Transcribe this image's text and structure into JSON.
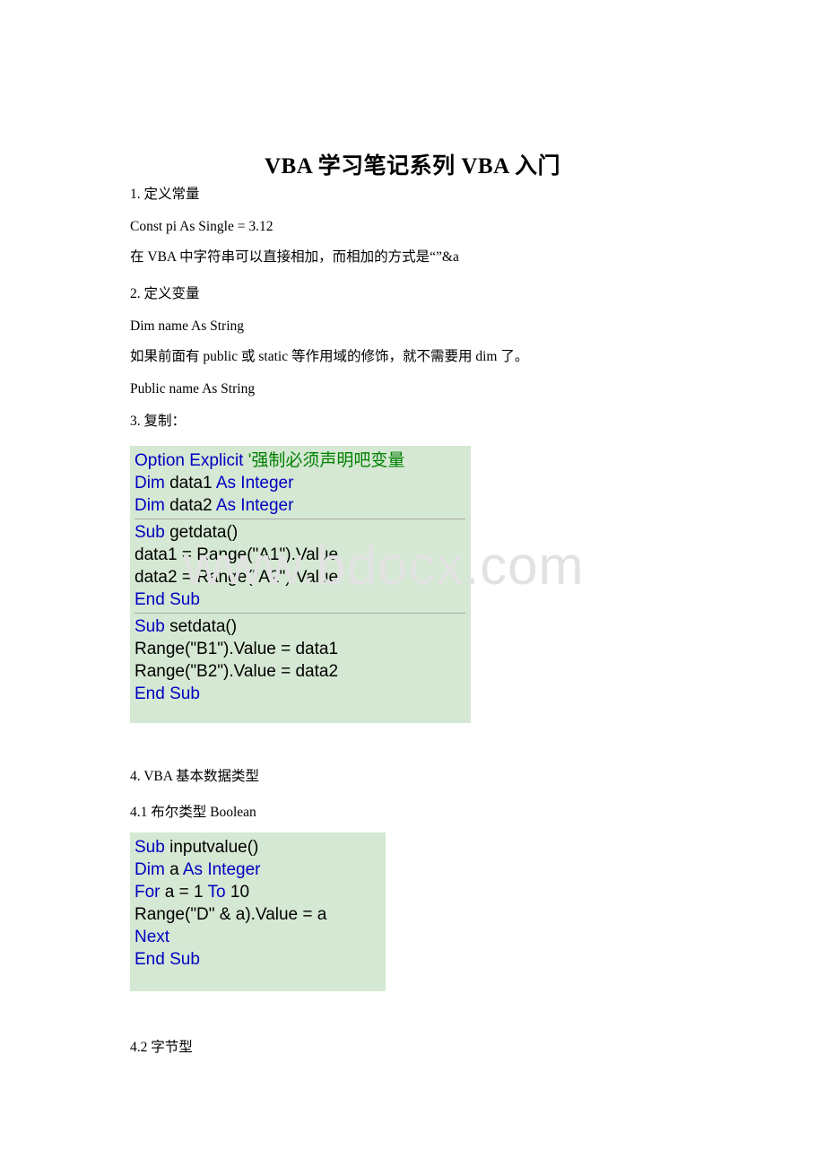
{
  "document": {
    "title": "VBA 学习笔记系列 VBA 入门",
    "watermark": "www.bdocx.com",
    "page_background": "#ffffff",
    "code_background": "#d5e8d3",
    "keyword_color": "#0000c0",
    "comment_color": "#008000",
    "identifier_color": "#000000",
    "watermark_color": "#e2e2e2"
  },
  "paragraphs": [
    {
      "text": "1. 定义常量"
    },
    {
      "text": "Const pi As Single = 3.12"
    },
    {
      "text": "在 VBA 中字符串可以直接相加，而相加的方式是“”&a"
    },
    {
      "text": "2. 定义变量"
    },
    {
      "text": "Dim name As String"
    },
    {
      "text": "如果前面有 public 或 static 等作用域的修饰，就不需要用 dim 了。"
    },
    {
      "text": "Public name As String"
    },
    {
      "text": "3. 复制："
    },
    {
      "text": "4. VBA 基本数据类型"
    },
    {
      "text": "4.1 布尔类型 Boolean"
    },
    {
      "text": "4.2 字节型"
    }
  ],
  "code_blocks": [
    {
      "name": "copy-example",
      "sections": [
        {
          "lines": [
            [
              {
                "t": "Option Explicit ",
                "c": "kw"
              },
              {
                "t": "'强制必须声明吧变量",
                "c": "cmt"
              }
            ],
            [
              {
                "t": "Dim ",
                "c": "kw"
              },
              {
                "t": "data1 ",
                "c": "idn"
              },
              {
                "t": "As Integer",
                "c": "kw"
              }
            ],
            [
              {
                "t": "Dim ",
                "c": "kw"
              },
              {
                "t": "data2 ",
                "c": "idn"
              },
              {
                "t": "As Integer",
                "c": "kw"
              }
            ]
          ]
        },
        {
          "lines": [
            [
              {
                "t": "Sub ",
                "c": "kw"
              },
              {
                "t": "getdata()",
                "c": "idn"
              }
            ],
            [
              {
                "t": "data1 = Range(\"A1\").Value",
                "c": "idn"
              }
            ],
            [
              {
                "t": "data2 = Range(\"A2\").Value",
                "c": "idn"
              }
            ],
            [
              {
                "t": "End Sub",
                "c": "kw"
              }
            ]
          ]
        },
        {
          "lines": [
            [
              {
                "t": "Sub ",
                "c": "kw"
              },
              {
                "t": "setdata()",
                "c": "idn"
              }
            ],
            [
              {
                "t": "Range(\"B1\").Value = data1",
                "c": "idn"
              }
            ],
            [
              {
                "t": "Range(\"B2\").Value = data2",
                "c": "idn"
              }
            ],
            [
              {
                "t": "End Sub",
                "c": "kw"
              }
            ]
          ]
        }
      ]
    },
    {
      "name": "boolean-example",
      "sections": [
        {
          "lines": [
            [
              {
                "t": "Sub ",
                "c": "kw"
              },
              {
                "t": "inputvalue()",
                "c": "idn"
              }
            ],
            [
              {
                "t": "Dim ",
                "c": "kw"
              },
              {
                "t": "a ",
                "c": "idn"
              },
              {
                "t": "As Integer",
                "c": "kw"
              }
            ],
            [
              {
                "t": "For ",
                "c": "kw"
              },
              {
                "t": "a = 1 ",
                "c": "idn"
              },
              {
                "t": "To ",
                "c": "kw"
              },
              {
                "t": "10",
                "c": "idn"
              }
            ],
            [
              {
                "t": "Range(\"D\" & a).Value = a",
                "c": "idn"
              }
            ],
            [
              {
                "t": "Next",
                "c": "kw"
              }
            ],
            [
              {
                "t": "End Sub",
                "c": "kw"
              }
            ]
          ]
        }
      ]
    }
  ],
  "layout": {
    "paragraph_tops": [
      207,
      243,
      277,
      318,
      354,
      388,
      424,
      460,
      856,
      896,
      1158
    ]
  }
}
